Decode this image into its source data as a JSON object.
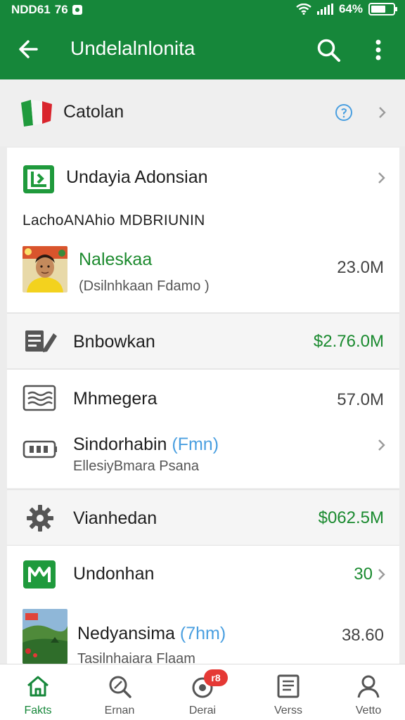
{
  "status_bar": {
    "left": "NDD61",
    "network": "76",
    "battery": "64%"
  },
  "header": {
    "title": "Undelalnlonita"
  },
  "country": {
    "label": "Catolan"
  },
  "section1": {
    "title": "Undayia Adonsian",
    "heading": "LachoANAhio MDBRIUNIN",
    "item": {
      "name": "Naleskaa",
      "desc": "(Dsilnhkaan Fdamo )",
      "value": "23.0M"
    }
  },
  "row_bnbowkan": {
    "label": "Bnbowkan",
    "value": "$2.76.0M"
  },
  "section2": {
    "item1": {
      "label": "Mhmegera",
      "value": "57.0M"
    },
    "item2": {
      "label": "Sindorhabin",
      "label_paren": "(Fmn)",
      "desc": "EllesiyBmara Psana"
    }
  },
  "row_vianhedan": {
    "label": "Vianhedan",
    "value": "$062.5M"
  },
  "section3": {
    "item1": {
      "label": "Undonhan",
      "value": "30"
    },
    "item2": {
      "label": "Nedyansima",
      "label_paren": "(7hm)",
      "value": "38.60",
      "desc": "Tasilnhaiara Flaam"
    }
  },
  "bottom_nav": [
    {
      "label": "Fakts",
      "icon": "home-icon"
    },
    {
      "label": "Ernan",
      "icon": "search-icon"
    },
    {
      "label": "Derai",
      "icon": "chat-icon",
      "badge": "r8"
    },
    {
      "label": "Verss",
      "icon": "document-icon"
    },
    {
      "label": "Vetto",
      "icon": "profile-icon"
    }
  ],
  "colors": {
    "primary": "#16873a",
    "accent_green": "#1a8a2f",
    "link_blue": "#4a9fe0",
    "badge_red": "#e53935"
  }
}
